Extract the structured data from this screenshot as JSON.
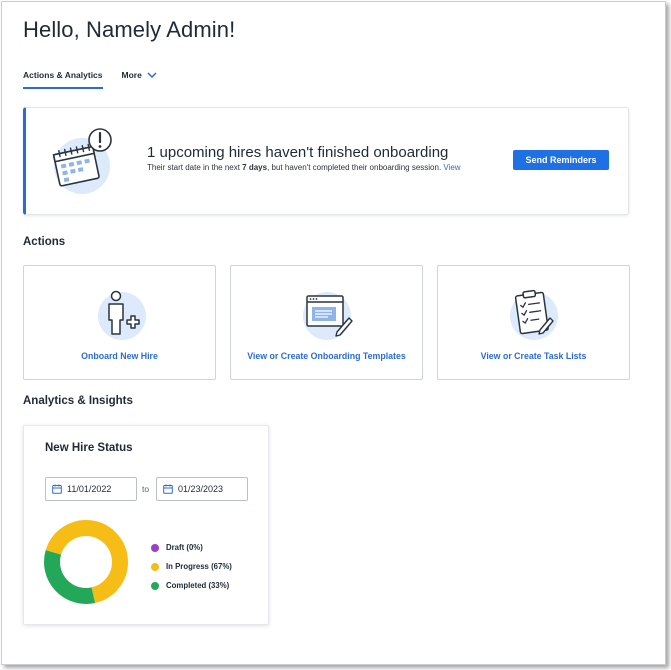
{
  "page": {
    "greeting": "Hello, Namely Admin!"
  },
  "tabs": [
    {
      "label": "Actions & Analytics",
      "active": true
    },
    {
      "label": "More",
      "active": false
    }
  ],
  "banner": {
    "headline": "1 upcoming hires haven't finished onboarding",
    "sub_before": "Their start date in the next ",
    "sub_bold": "7 days",
    "sub_after": ", but haven't completed their onboarding session. ",
    "link": "View",
    "button": "Send Reminders",
    "icon": "calendar-alert-icon"
  },
  "actions": {
    "heading": "Actions",
    "cards": [
      {
        "label": "Onboard New Hire",
        "icon": "person-add-icon"
      },
      {
        "label": "View or Create Onboarding Templates",
        "icon": "template-edit-icon"
      },
      {
        "label": "View or Create Task Lists",
        "icon": "clipboard-checklist-icon"
      }
    ]
  },
  "analytics": {
    "heading": "Analytics & Insights",
    "panel_title": "New Hire Status",
    "date_from": "11/01/2022",
    "date_to_label": "to",
    "date_to": "01/23/2023"
  },
  "chart_data": {
    "type": "pie",
    "categories": [
      "Draft",
      "In Progress",
      "Completed"
    ],
    "values": [
      0,
      67,
      33
    ],
    "legend_labels": [
      "Draft (0%)",
      "In Progress (67%)",
      "Completed (33%)"
    ],
    "colors": [
      "#9b3fc8",
      "#f6bd16",
      "#23a85a"
    ],
    "legend_position": "right"
  },
  "colors": {
    "accent": "#2b6bd6",
    "button": "#1f6fe5"
  }
}
